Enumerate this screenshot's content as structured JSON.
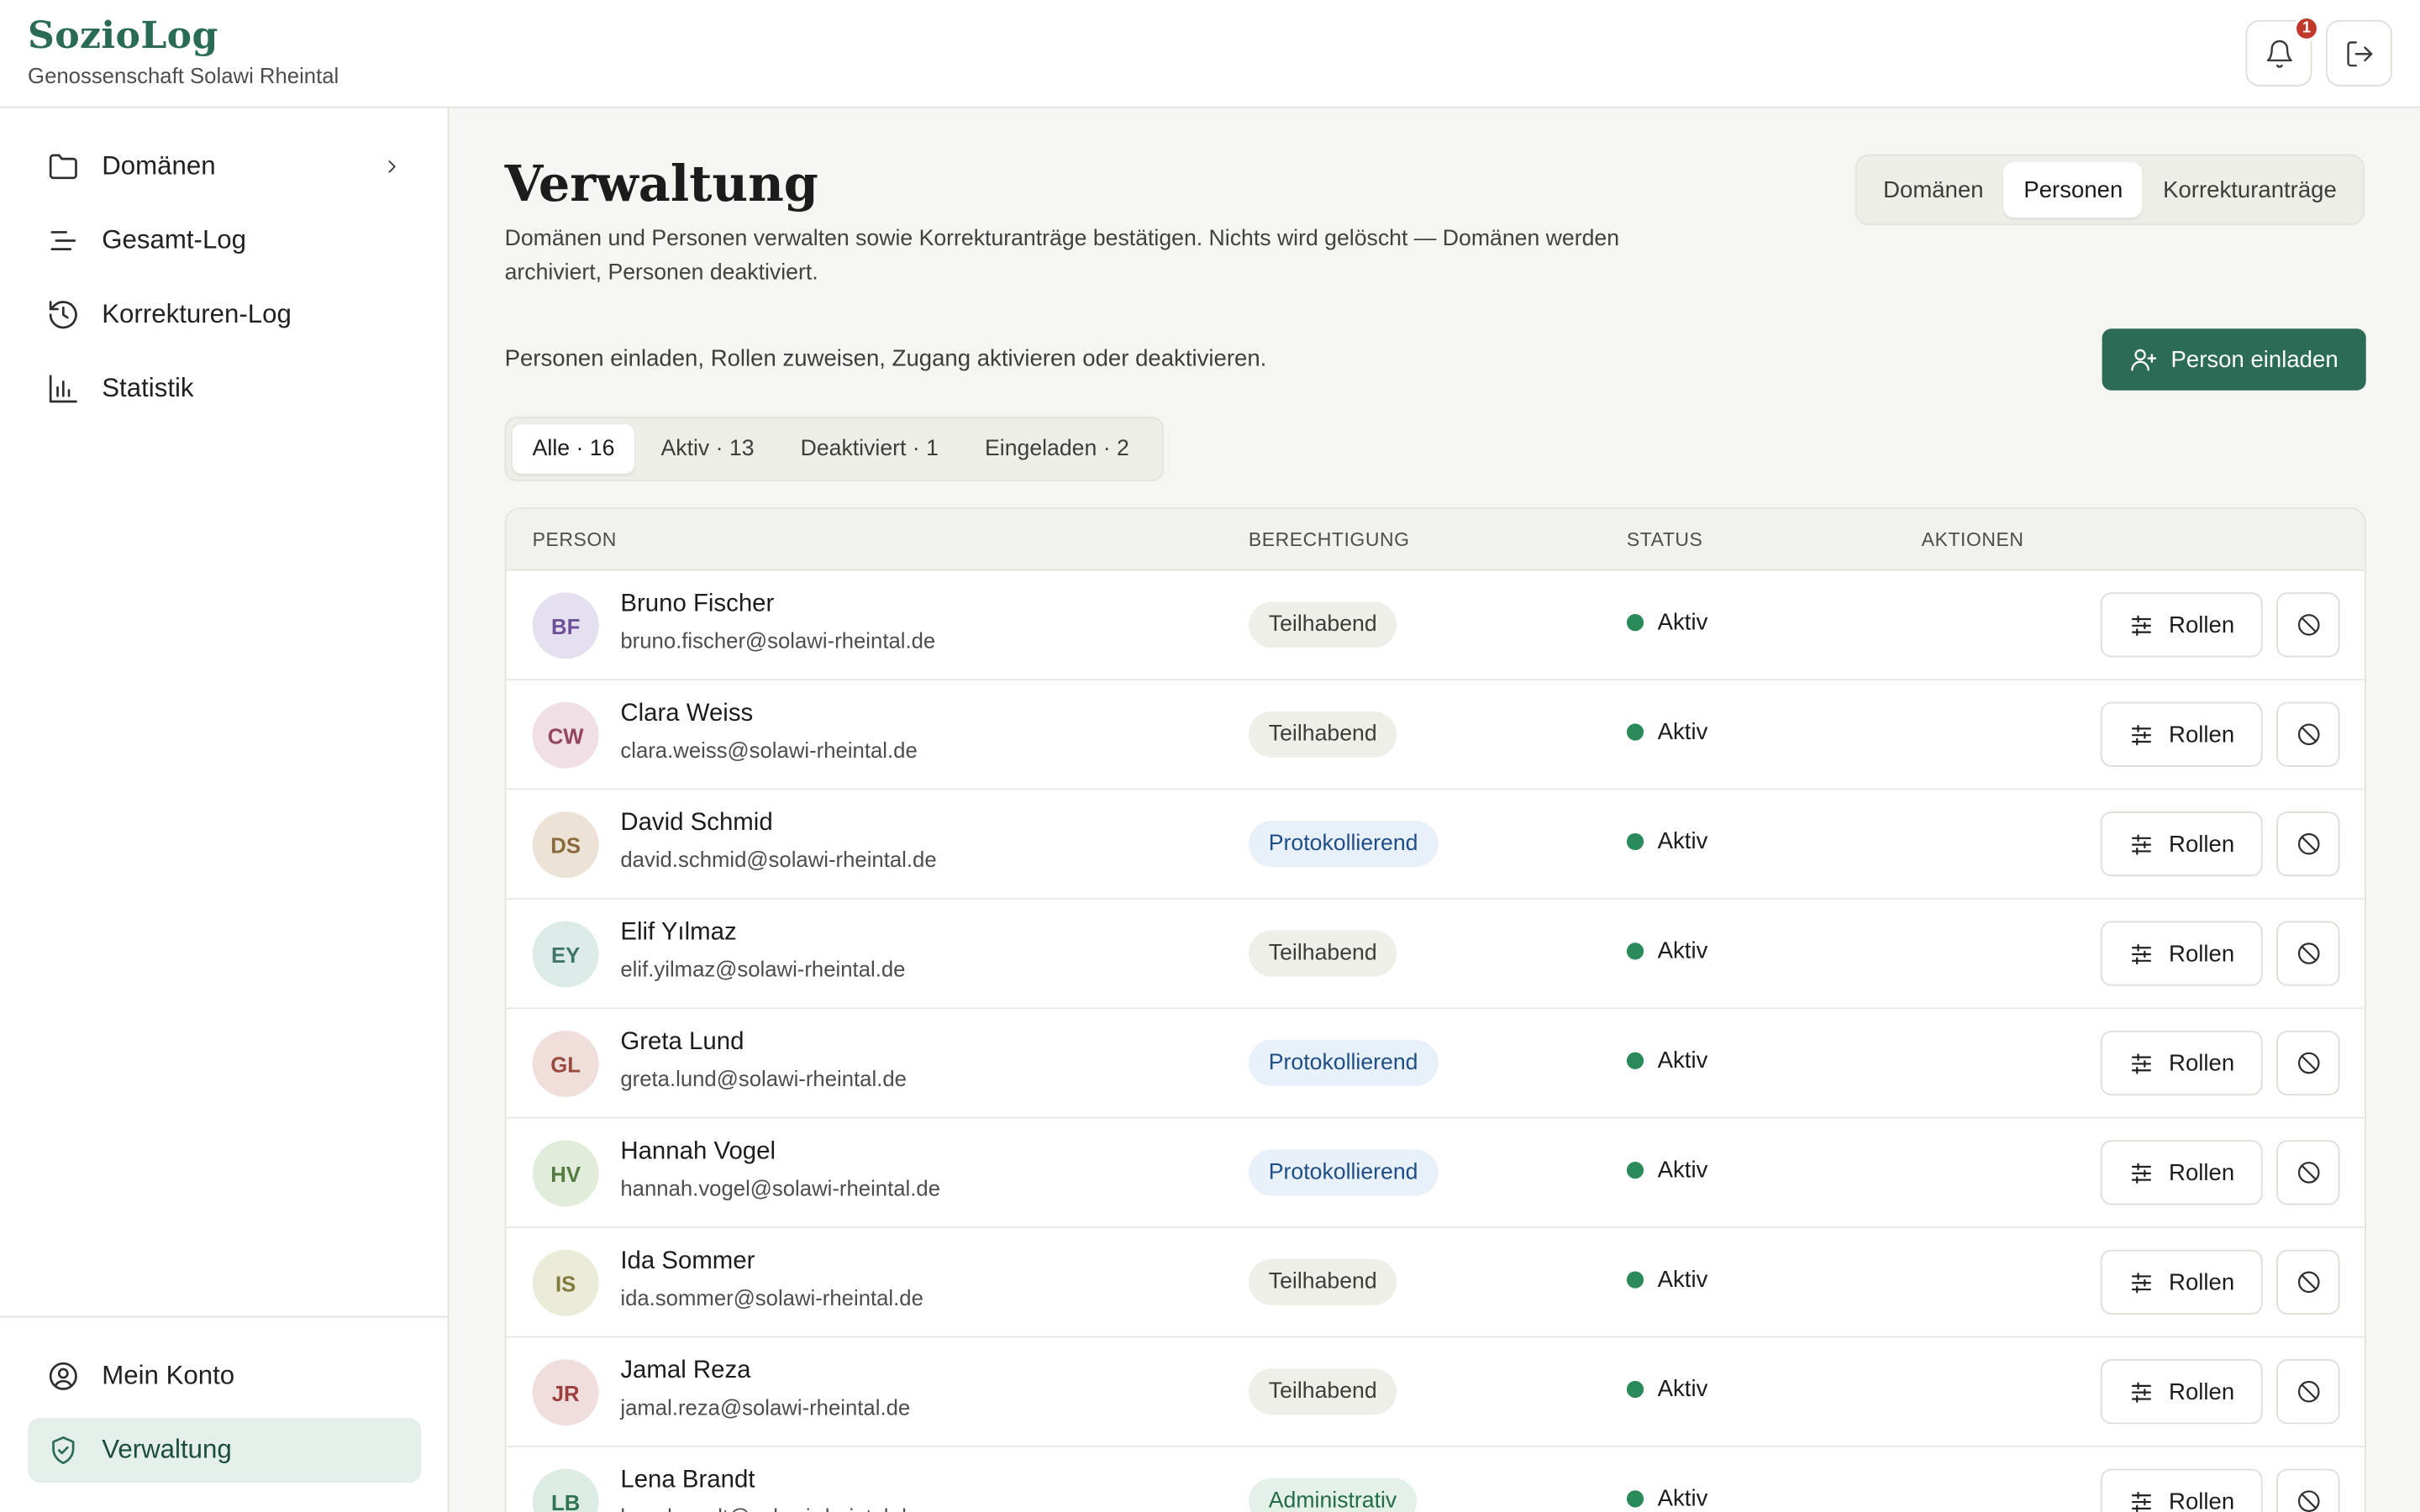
{
  "app": {
    "title": "SozioLog",
    "subtitle": "Genossenschaft Solawi Rheintal",
    "notification_count": "1"
  },
  "sidebar": {
    "items": [
      {
        "label": "Domänen",
        "icon": "folder-icon"
      },
      {
        "label": "Gesamt-Log",
        "icon": "list-icon"
      },
      {
        "label": "Korrekturen-Log",
        "icon": "history-icon"
      },
      {
        "label": "Statistik",
        "icon": "bar-chart-icon"
      }
    ],
    "bottom": [
      {
        "label": "Mein Konto",
        "icon": "user-circle-icon"
      },
      {
        "label": "Verwaltung",
        "icon": "shield-check-icon",
        "active": true
      }
    ]
  },
  "main": {
    "title": "Verwaltung",
    "description": "Domänen und Personen verwalten sowie Korrekturanträge bestätigen. Nichts wird gelöscht — Domänen werden archiviert, Personen deaktiviert.",
    "tabs": [
      {
        "label": "Domänen"
      },
      {
        "label": "Personen",
        "active": true
      },
      {
        "label": "Korrekturanträge"
      }
    ],
    "hint": "Personen einladen, Rollen zuweisen, Zugang aktivieren oder deaktivieren.",
    "invite_label": "Person einladen",
    "filters": [
      {
        "label": "Alle · 16",
        "active": true
      },
      {
        "label": "Aktiv · 13"
      },
      {
        "label": "Deaktiviert · 1"
      },
      {
        "label": "Eingeladen · 2"
      }
    ],
    "table": {
      "headers": [
        "PERSON",
        "BERECHTIGUNG",
        "STATUS",
        "AKTIONEN"
      ],
      "roles_button": "Rollen",
      "rows": [
        {
          "initials": "BF",
          "name": "Bruno Fischer",
          "email": "bruno.fischer@solawi-rheintal.de",
          "role": "Teilhabend",
          "status": "Aktiv",
          "avatar_bg": "#e6dff0",
          "avatar_fg": "#6b4f97"
        },
        {
          "initials": "CW",
          "name": "Clara Weiss",
          "email": "clara.weiss@solawi-rheintal.de",
          "role": "Teilhabend",
          "status": "Aktiv",
          "avatar_bg": "#f0dfe5",
          "avatar_fg": "#92455f"
        },
        {
          "initials": "DS",
          "name": "David Schmid",
          "email": "david.schmid@solawi-rheintal.de",
          "role": "Protokollierend",
          "status": "Aktiv",
          "avatar_bg": "#ece3d6",
          "avatar_fg": "#8a6a3c"
        },
        {
          "initials": "EY",
          "name": "Elif Yılmaz",
          "email": "elif.yilmaz@solawi-rheintal.de",
          "role": "Teilhabend",
          "status": "Aktiv",
          "avatar_bg": "#dcebe7",
          "avatar_fg": "#3f7668"
        },
        {
          "initials": "GL",
          "name": "Greta Lund",
          "email": "greta.lund@solawi-rheintal.de",
          "role": "Protokollierend",
          "status": "Aktiv",
          "avatar_bg": "#efdeda",
          "avatar_fg": "#984a3c"
        },
        {
          "initials": "HV",
          "name": "Hannah Vogel",
          "email": "hannah.vogel@solawi-rheintal.de",
          "role": "Protokollierend",
          "status": "Aktiv",
          "avatar_bg": "#e2ecdb",
          "avatar_fg": "#557a3f"
        },
        {
          "initials": "IS",
          "name": "Ida Sommer",
          "email": "ida.sommer@solawi-rheintal.de",
          "role": "Teilhabend",
          "status": "Aktiv",
          "avatar_bg": "#ecebd9",
          "avatar_fg": "#807a3c"
        },
        {
          "initials": "JR",
          "name": "Jamal Reza",
          "email": "jamal.reza@solawi-rheintal.de",
          "role": "Teilhabend",
          "status": "Aktiv",
          "avatar_bg": "#f0dede",
          "avatar_fg": "#9c3f3f"
        },
        {
          "initials": "LB",
          "name": "Lena Brandt",
          "email": "lena.brandt@solawi-rheintal.de",
          "role": "Administrativ",
          "status": "Aktiv",
          "avatar_bg": "#dcece3",
          "avatar_fg": "#2f7352"
        }
      ]
    }
  },
  "colors": {
    "accent": "#2c6b55",
    "status_active": "#2b8a5a"
  }
}
